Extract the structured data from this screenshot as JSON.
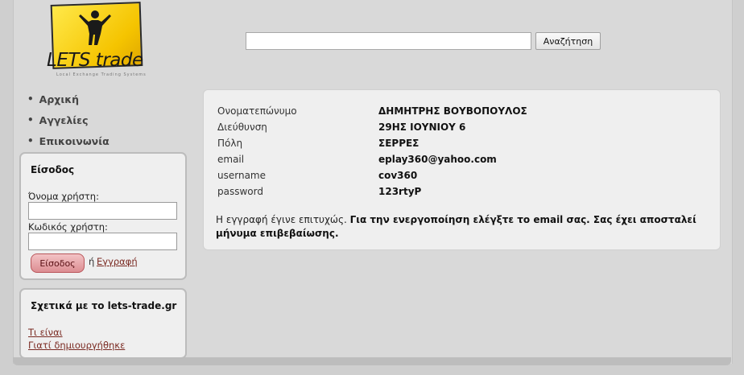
{
  "logo": {
    "text": "LETS trade",
    "tagline": "Local Exchange Trading Systems"
  },
  "search": {
    "button_label": "Αναζήτηση",
    "value": ""
  },
  "nav": {
    "items": [
      {
        "label": "Αρχική"
      },
      {
        "label": "Αγγελίες"
      },
      {
        "label": "Επικοινωνία"
      }
    ]
  },
  "login": {
    "title": "Είσοδος",
    "username_label": "Όνομα χρήστη:",
    "password_label": "Κωδικός χρήστη:",
    "username_value": "",
    "password_value": "",
    "button_label": "Είσοδος",
    "or_text": "ή",
    "register_link": "Εγγραφή"
  },
  "about": {
    "title": "Σχετικά με το lets-trade.gr",
    "links": [
      {
        "label": "Τι είναι"
      },
      {
        "label": "Γιατί δημιουργήθηκε"
      }
    ]
  },
  "profile": {
    "rows": [
      {
        "label": "Ονοματεπώνυμο",
        "value": "ΔΗΜΗΤΡΗΣ ΒΟΥΒΟΠΟΥΛΟΣ"
      },
      {
        "label": "Διεύθυνση",
        "value": "29ΗΣ ΙΟΥΝΙΟΥ 6"
      },
      {
        "label": "Πόλη",
        "value": "ΣΕΡΡΕΣ"
      },
      {
        "label": "email",
        "value": "eplay360@yahoo.com"
      },
      {
        "label": "username",
        "value": "cov360"
      },
      {
        "label": "password",
        "value": "123rtyP"
      }
    ],
    "message_prefix": "Η εγγραφή έγινε επιτυχώς.",
    "message_bold": "Για την ενεργοποίηση ελέγξτε το email σας. Σας έχει αποσταλεί μήνυμα επιβεβαίωσης."
  },
  "colors": {
    "background": "#d9d9d9",
    "panel": "#efefef",
    "link": "#7a2a22",
    "login_button": "#dc8d92",
    "logo_yellow": "#f5c400"
  }
}
